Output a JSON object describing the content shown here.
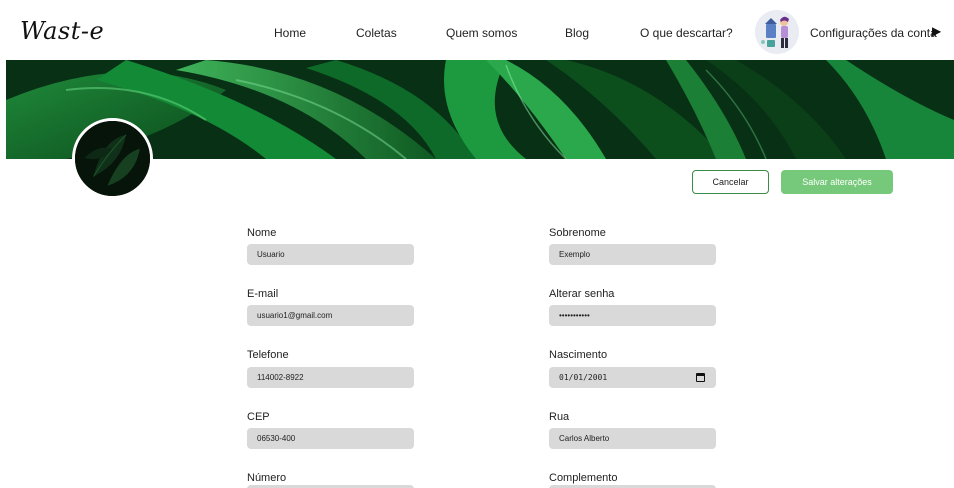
{
  "header": {
    "logo": "Wast-e",
    "nav": [
      "Home",
      "Coletas",
      "Quem somos",
      "Blog",
      "O que descartar?"
    ],
    "account_label": "Configurações da conta",
    "caret": "▶"
  },
  "actions": {
    "cancel_label": "Cancelar",
    "save_label": "Salvar alterações"
  },
  "form": {
    "nome": {
      "label": "Nome",
      "value": "Usuario"
    },
    "sobrenome": {
      "label": "Sobrenome",
      "value": "Exemplo"
    },
    "email": {
      "label": "E-mail",
      "value": "usuario1@gmail.com"
    },
    "senha": {
      "label": "Alterar senha",
      "value": "•••••••••••"
    },
    "telefone": {
      "label": "Telefone",
      "value": "114002-8922"
    },
    "nascimento": {
      "label": "Nascimento",
      "value": "01/01/2001"
    },
    "cep": {
      "label": "CEP",
      "value": "06530-400"
    },
    "rua": {
      "label": "Rua",
      "value": "Carlos Alberto"
    },
    "numero": {
      "label": "Número"
    },
    "complemento": {
      "label": "Complemento"
    }
  },
  "colors": {
    "accent": "#76c97a",
    "outline": "#3a8a4a",
    "input_bg": "#d9d9d9",
    "banner": "#0f5a22"
  }
}
